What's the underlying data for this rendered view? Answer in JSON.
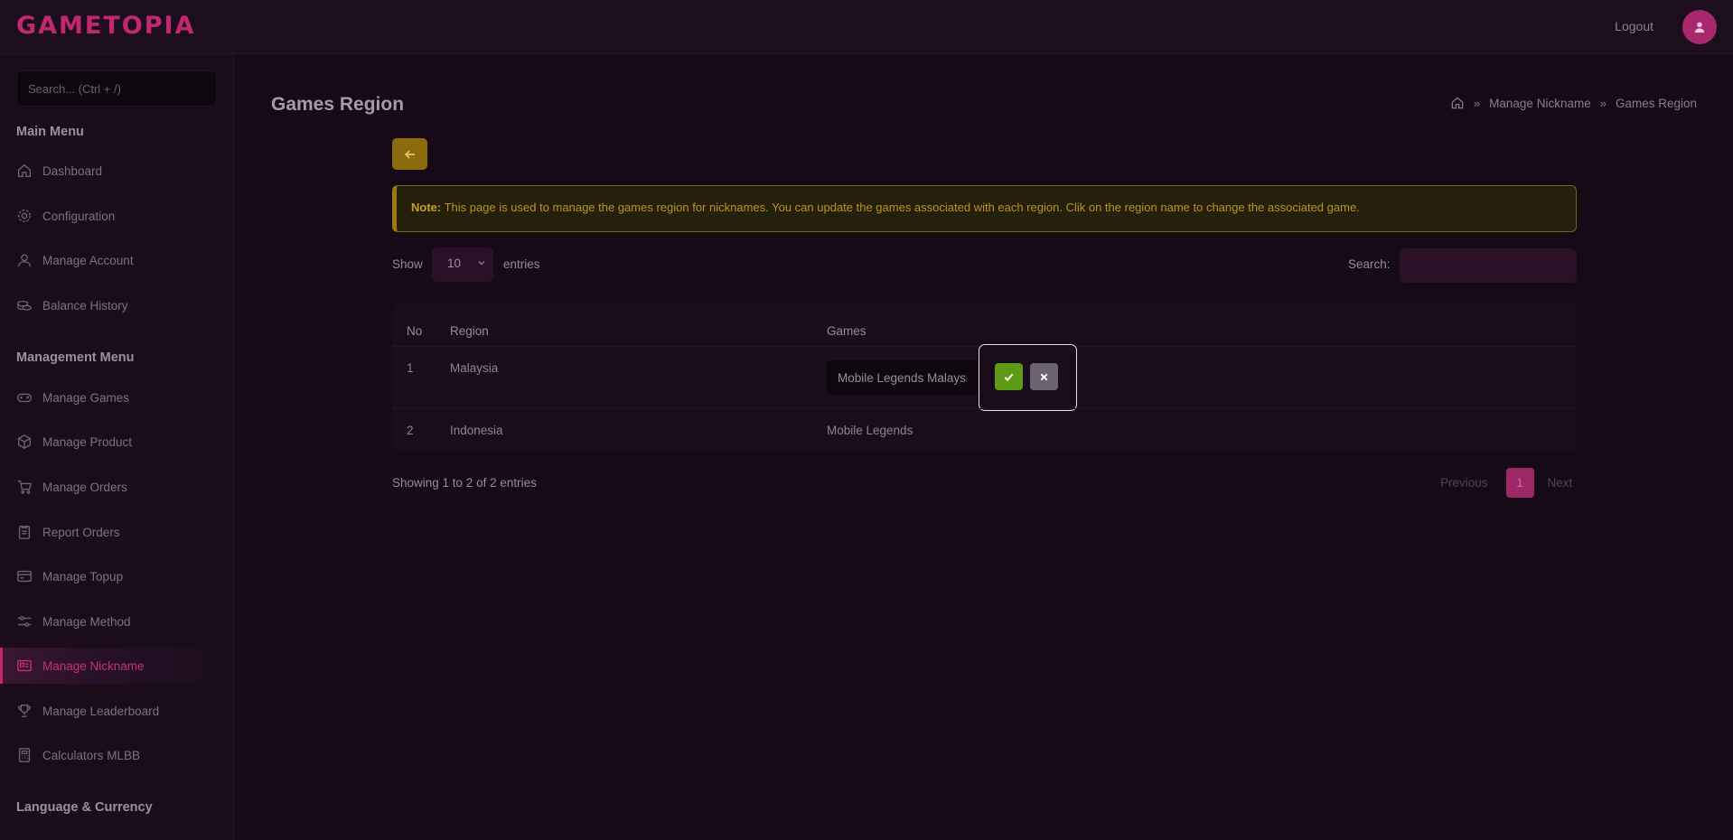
{
  "brand": {
    "logo": "GAMETOPIA",
    "accent": "#c2286f"
  },
  "header": {
    "logout": "Logout",
    "avatar_icon": "user-icon"
  },
  "sidebar": {
    "search_placeholder": "Search... (Ctrl + /)",
    "main_menu_title": "Main Menu",
    "main_items": [
      {
        "label": "Dashboard",
        "icon": "home-icon"
      },
      {
        "label": "Configuration",
        "icon": "gear-icon"
      },
      {
        "label": "Manage Account",
        "icon": "user-icon"
      },
      {
        "label": "Balance History",
        "icon": "coins-icon"
      }
    ],
    "management_title": "Management Menu",
    "management_items": [
      {
        "label": "Manage Games",
        "icon": "gamepad-icon"
      },
      {
        "label": "Manage Product",
        "icon": "box-icon"
      },
      {
        "label": "Manage Orders",
        "icon": "cart-icon"
      },
      {
        "label": "Report Orders",
        "icon": "clipboard-icon"
      },
      {
        "label": "Manage Topup",
        "icon": "card-icon"
      },
      {
        "label": "Manage Method",
        "icon": "sliders-icon"
      },
      {
        "label": "Manage Nickname",
        "icon": "id-card-icon",
        "active": true
      },
      {
        "label": "Manage Leaderboard",
        "icon": "trophy-icon"
      },
      {
        "label": "Calculators MLBB",
        "icon": "calculator-icon"
      }
    ],
    "language_title": "Language & Currency"
  },
  "page": {
    "title": "Games Region",
    "breadcrumb": [
      "Manage Nickname",
      "Games Region"
    ],
    "note_label": "Note:",
    "note_text": " This page is used to manage the games region for nicknames. You can update the games associated with each region. Clik on the region name to change the associated game."
  },
  "table_controls": {
    "show_label": "Show",
    "page_length": "10",
    "entries_label": "entries",
    "search_label": "Search:",
    "search_value": ""
  },
  "table": {
    "columns": [
      "No",
      "Region",
      "Games"
    ],
    "rows": [
      {
        "no": "1",
        "region": "Malaysia",
        "games": "Mobile Legends Malaysia",
        "editing": true
      },
      {
        "no": "2",
        "region": "Indonesia",
        "games": "Mobile Legends"
      }
    ]
  },
  "footer": {
    "showing": "Showing 1 to 2 of 2 entries",
    "previous": "Previous",
    "current_page": "1",
    "next": "Next"
  }
}
